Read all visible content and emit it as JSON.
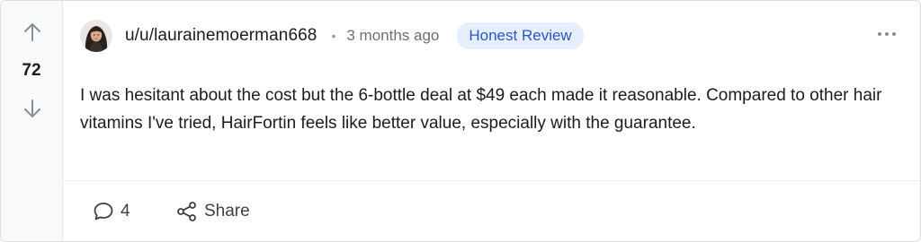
{
  "post": {
    "votes": "72",
    "username": "u/u/laurainemoerman668",
    "separator": "•",
    "timestamp": "3 months ago",
    "badge": "Honest Review",
    "body": "I was hesitant about the cost but the 6-bottle deal at $49 each made it reasonable. Compared to other hair vitamins I've tried, HairFortin feels like better value, especially with the guarantee.",
    "comment_count": "4",
    "share_label": "Share"
  },
  "icons": {
    "upvote": "arrow-up-icon",
    "downvote": "arrow-down-icon",
    "more": "more-horizontal-icon",
    "comments": "comment-icon",
    "share": "share-icon"
  },
  "colors": {
    "badge_bg": "#e6efff",
    "badge_text": "#2a56c6",
    "text": "#1c1c1c",
    "muted": "#6b6f76",
    "vote_column_bg": "#f8f9fa"
  }
}
